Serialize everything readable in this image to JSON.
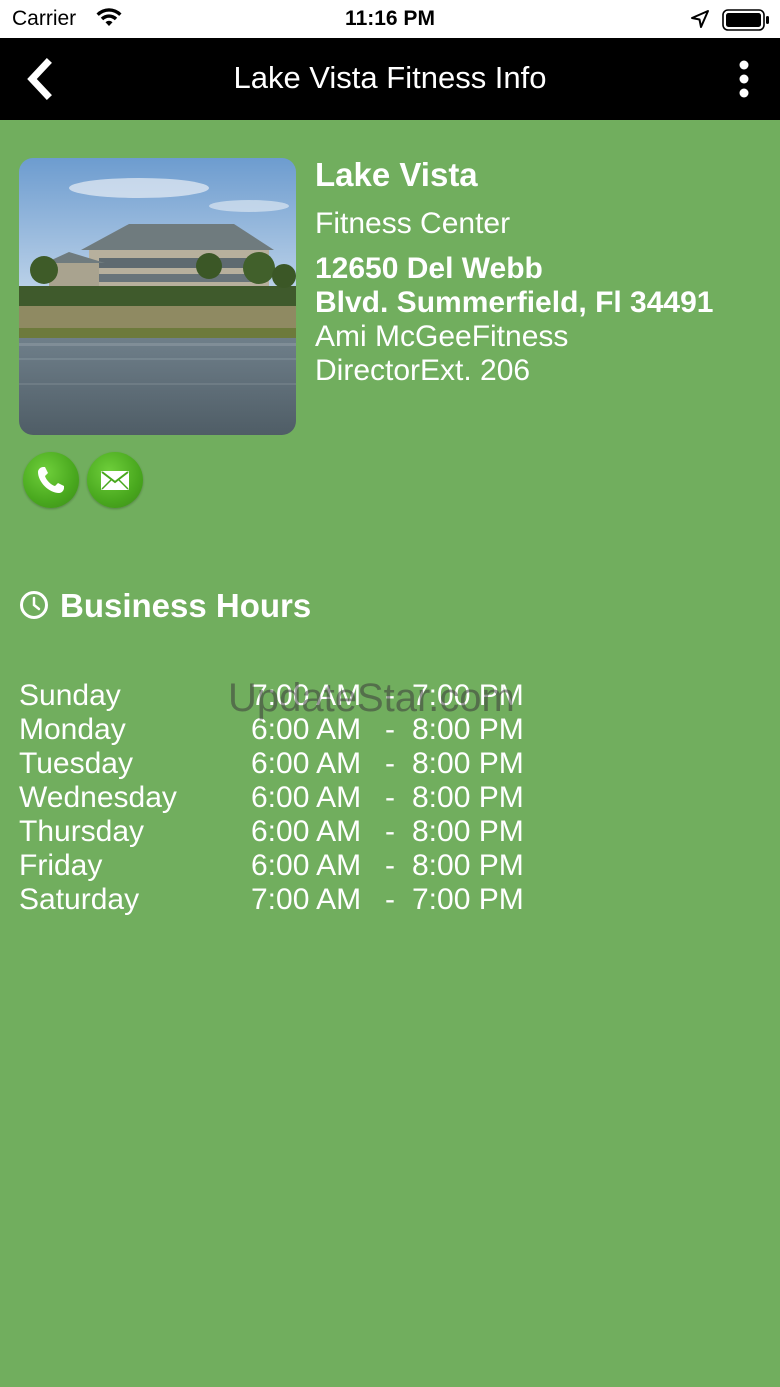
{
  "status_bar": {
    "carrier": "Carrier",
    "time": "11:16 PM"
  },
  "nav": {
    "title": "Lake Vista Fitness Info"
  },
  "profile": {
    "name": "Lake Vista",
    "subtitle": "Fitness Center",
    "address_line1": "12650 Del Webb",
    "address_line2": "Blvd. Summerfield, Fl 34491",
    "contact_line1": "Ami McGeeFitness",
    "contact_line2": "DirectorExt. 206"
  },
  "hours": {
    "title": "Business Hours",
    "rows": [
      {
        "day": "Sunday",
        "open": "7:00 AM",
        "dash": "-",
        "close": "7:00 PM"
      },
      {
        "day": "Monday",
        "open": "6:00 AM",
        "dash": "-",
        "close": "8:00 PM"
      },
      {
        "day": "Tuesday",
        "open": "6:00 AM",
        "dash": "-",
        "close": "8:00 PM"
      },
      {
        "day": "Wednesday",
        "open": "6:00 AM",
        "dash": "-",
        "close": "8:00 PM"
      },
      {
        "day": "Thursday",
        "open": "6:00 AM",
        "dash": "-",
        "close": "8:00 PM"
      },
      {
        "day": "Friday",
        "open": "6:00 AM",
        "dash": "-",
        "close": "8:00 PM"
      },
      {
        "day": "Saturday",
        "open": "7:00 AM",
        "dash": "-",
        "close": "7:00 PM"
      }
    ]
  },
  "watermark": "UpdateStar.com",
  "icons": {
    "back": "chevron-left-icon",
    "more": "more-vertical-icon",
    "call": "phone-icon",
    "email": "mail-icon",
    "clock": "clock-icon"
  },
  "colors": {
    "background": "#71ae5e",
    "nav": "#000000",
    "action_button": "#49a81e"
  }
}
